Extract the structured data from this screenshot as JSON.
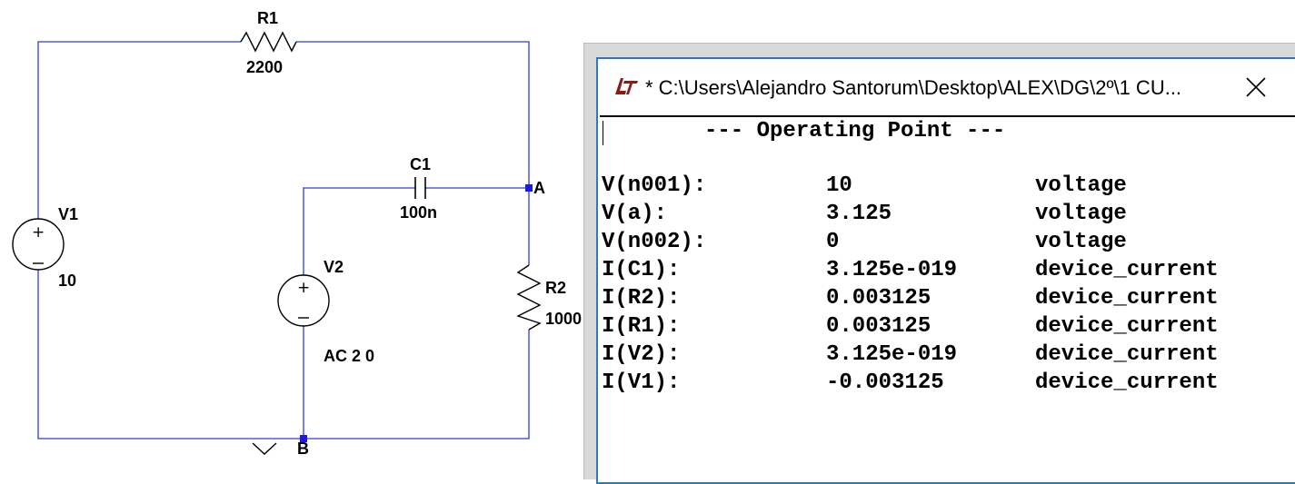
{
  "schematic": {
    "components": {
      "r1": {
        "name": "R1",
        "value": "2200"
      },
      "r2": {
        "name": "R2",
        "value": "1000"
      },
      "c1": {
        "name": "C1",
        "value": "100n"
      },
      "v1": {
        "name": "V1",
        "value": "10"
      },
      "v2": {
        "name": "V2",
        "value": "AC 2 0"
      }
    },
    "nodes": {
      "a": "A",
      "b": "B"
    },
    "colors": {
      "wire": "#2e3cd6",
      "junction": "#1a1ae6",
      "component": "#000000"
    }
  },
  "output_window": {
    "title": "* C:\\Users\\Alejandro Santorum\\Desktop\\ALEX\\DG\\2º\\1 CU...",
    "app_icon": "ltspice-icon",
    "close_glyph": "close-icon",
    "header": "--- Operating Point ---",
    "rows": [
      {
        "name": "V(n001):",
        "value": "10",
        "type": "voltage"
      },
      {
        "name": "V(a):",
        "value": "3.125",
        "type": "voltage"
      },
      {
        "name": "V(n002):",
        "value": "0",
        "type": "voltage"
      },
      {
        "name": "I(C1):",
        "value": "3.125e-019",
        "type": "device_current"
      },
      {
        "name": "I(R2):",
        "value": "0.003125",
        "type": "device_current"
      },
      {
        "name": "I(R1):",
        "value": "0.003125",
        "type": "device_current"
      },
      {
        "name": "I(V2):",
        "value": "3.125e-019",
        "type": "device_current"
      },
      {
        "name": "I(V1):",
        "value": "-0.003125",
        "type": "device_current"
      }
    ],
    "colors": {
      "border": "#2f78c4",
      "icon": "#8b1a1a"
    }
  }
}
